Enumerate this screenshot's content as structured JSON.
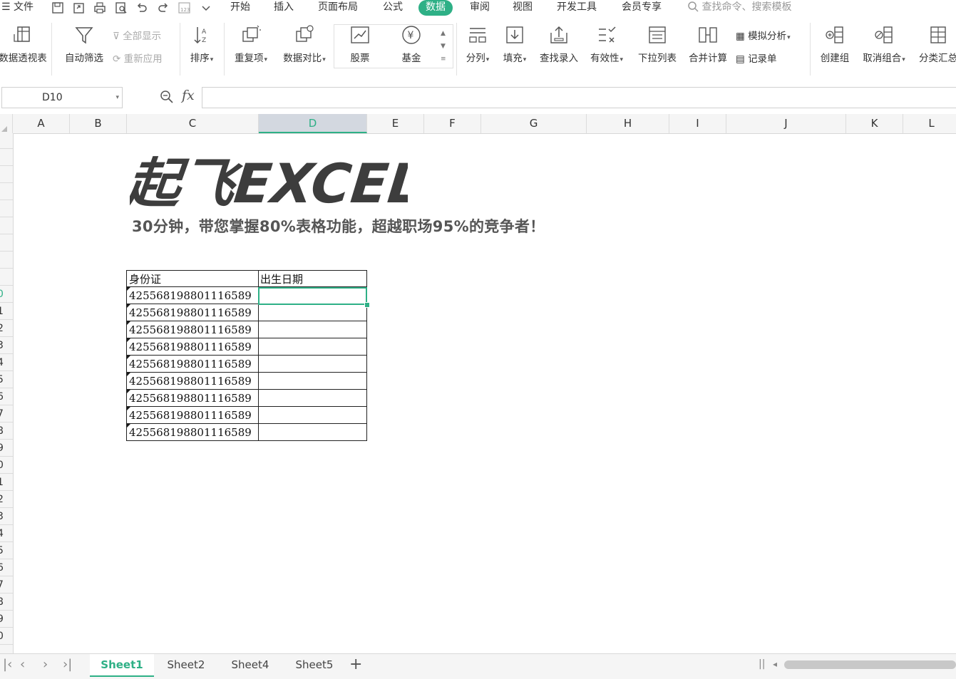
{
  "menubar": {
    "file_label": "文件",
    "tabs": [
      "开始",
      "插入",
      "页面布局",
      "公式",
      "数据",
      "审阅",
      "视图",
      "开发工具",
      "会员专享"
    ],
    "active_tab": "数据",
    "search_placeholder": "查找命令、搜索模板"
  },
  "ribbon": {
    "pivot": "数据透视表",
    "autofilter": "自动筛选",
    "show_all": "全部显示",
    "reapply": "重新应用",
    "sort": "排序",
    "duplicates": "重复项",
    "compare": "数据对比",
    "stock": "股票",
    "fund": "基金",
    "split": "分列",
    "fill": "填充",
    "lookup": "查找录入",
    "validation": "有效性",
    "dropdown": "下拉列表",
    "consolidate": "合并计算",
    "whatif": "模拟分析",
    "record": "记录单",
    "group": "创建组",
    "ungroup": "取消组合",
    "subtotal": "分类汇总"
  },
  "formula_bar": {
    "name_box": "D10",
    "fx_label": "fx",
    "value": ""
  },
  "columns": [
    "A",
    "B",
    "C",
    "D",
    "E",
    "F",
    "G",
    "H",
    "I",
    "J",
    "K",
    "L"
  ],
  "selected_column": "D",
  "rows": [
    "",
    "",
    "",
    "",
    "",
    "",
    "",
    "",
    "",
    "0",
    "1",
    "2",
    "3",
    "4",
    "5",
    "6",
    "7",
    "8",
    "9",
    "0",
    "1",
    "2",
    "3",
    "4",
    "5",
    "6",
    "7",
    "8",
    "9",
    "0"
  ],
  "sheet": {
    "logo_text": "起飞EXCEL",
    "subtitle": "30分钟，带您掌握80%表格功能，超越职场95%的竞争者！",
    "table": {
      "headers": [
        "身份证",
        "出生日期"
      ],
      "ids": [
        "425568198801116589",
        "425568198801116589",
        "425568198801116589",
        "425568198801116589",
        "425568198801116589",
        "425568198801116589",
        "425568198801116589",
        "425568198801116589",
        "425568198801116589"
      ]
    }
  },
  "sheet_tabs": [
    "Sheet1",
    "Sheet2",
    "Sheet4",
    "Sheet5"
  ],
  "active_sheet": "Sheet1",
  "colors": {
    "accent": "#2eb086",
    "logo": "#3d3d3d"
  }
}
